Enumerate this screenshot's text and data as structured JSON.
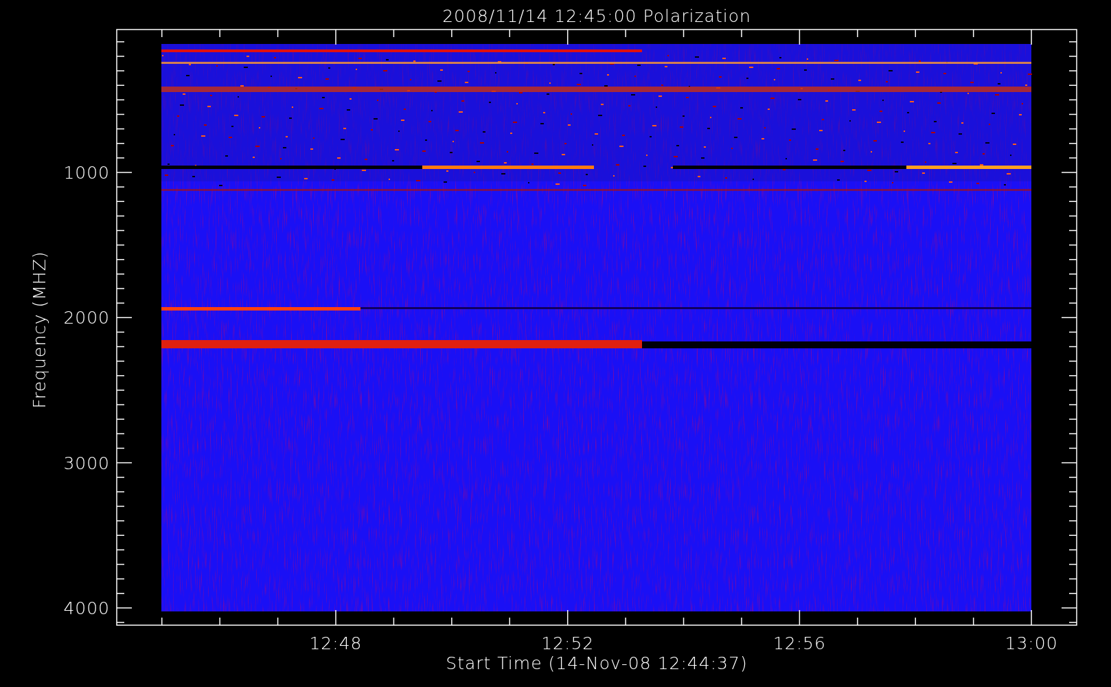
{
  "title": "2008/11/14 12:45:00 Polarization",
  "y_axis": {
    "label": "Frequency (MHZ)",
    "ticks": [
      "1000",
      "2000",
      "3000",
      "4000"
    ]
  },
  "x_axis": {
    "label": "Start Time (14-Nov-08 12:44:37)",
    "ticks": [
      "12:48",
      "12:52",
      "12:56",
      "13:00"
    ]
  }
}
